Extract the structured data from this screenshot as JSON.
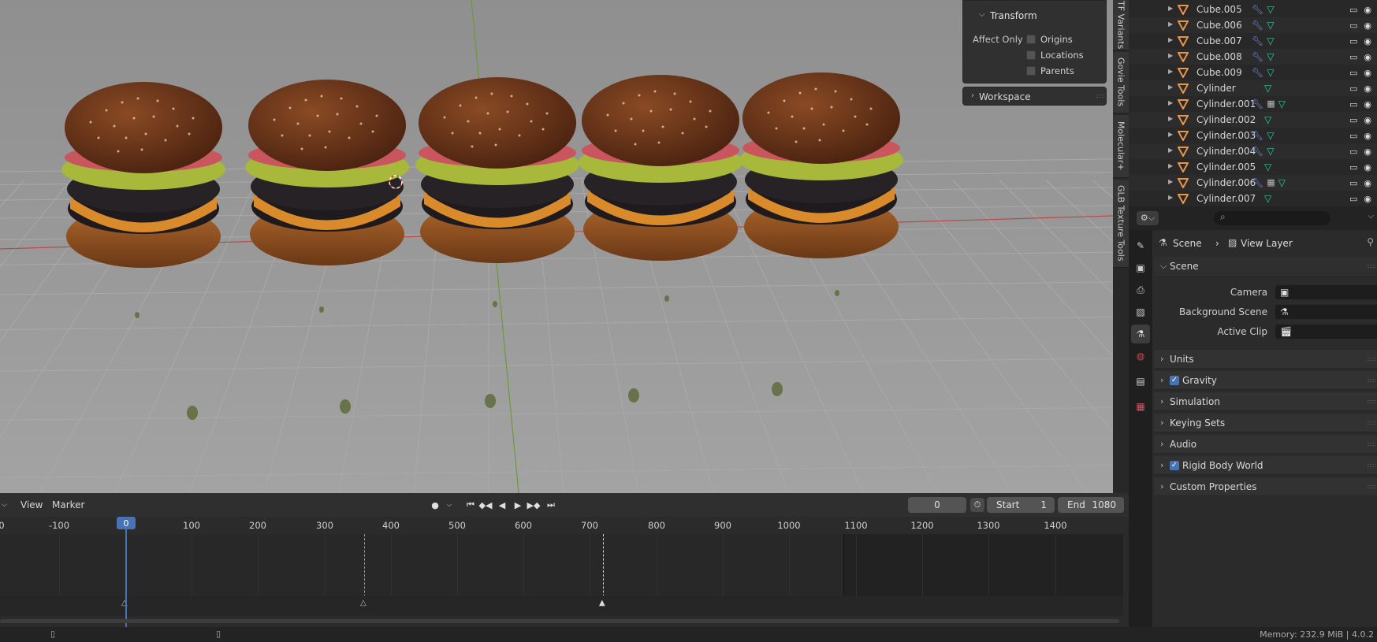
{
  "transform_panel": {
    "title": "Transform",
    "affect_only_label": "Affect Only",
    "options": [
      "Origins",
      "Locations",
      "Parents"
    ]
  },
  "workspace_panel": {
    "title": "Workspace"
  },
  "sidebar_tabs": [
    "TF Variants",
    "Govie Tools",
    "Molecular+",
    "GLB Texture Tools"
  ],
  "timeline": {
    "menus": {
      "view": "View",
      "marker": "Marker"
    },
    "current_frame_field": "0",
    "start_label": "Start",
    "start_value": "1",
    "end_label": "End",
    "end_value": "1080",
    "current_frame_badge": "0",
    "ruler_ticks": [
      "0",
      "-100",
      "100",
      "200",
      "300",
      "400",
      "500",
      "600",
      "700",
      "800",
      "900",
      "1000",
      "1100",
      "1200",
      "1300",
      "1400"
    ]
  },
  "outliner": {
    "rows": [
      {
        "name": "Cube.005",
        "mods": [
          "wrench",
          "mesh"
        ]
      },
      {
        "name": "Cube.006",
        "mods": [
          "wrench",
          "mesh"
        ]
      },
      {
        "name": "Cube.007",
        "mods": [
          "wrench",
          "mesh"
        ]
      },
      {
        "name": "Cube.008",
        "mods": [
          "wrench",
          "mesh"
        ]
      },
      {
        "name": "Cube.009",
        "mods": [
          "wrench",
          "mesh"
        ]
      },
      {
        "name": "Cylinder",
        "mods": [
          "mesh"
        ]
      },
      {
        "name": "Cylinder.001",
        "mods": [
          "wrench",
          "grid",
          "mesh"
        ]
      },
      {
        "name": "Cylinder.002",
        "mods": [
          "mesh"
        ]
      },
      {
        "name": "Cylinder.003",
        "mods": [
          "wrench",
          "mesh"
        ]
      },
      {
        "name": "Cylinder.004",
        "mods": [
          "wrench",
          "mesh"
        ]
      },
      {
        "name": "Cylinder.005",
        "mods": [
          "mesh"
        ]
      },
      {
        "name": "Cylinder.006",
        "mods": [
          "wrench",
          "grid",
          "mesh"
        ]
      },
      {
        "name": "Cylinder.007",
        "mods": [
          "mesh"
        ]
      }
    ]
  },
  "properties": {
    "breadcrumb": {
      "scene": "Scene",
      "view_layer": "View Layer"
    },
    "scene_section": "Scene",
    "fields": {
      "camera": "Camera",
      "background_scene": "Background Scene",
      "active_clip": "Active Clip"
    },
    "sections": [
      {
        "label": "Units",
        "checkbox": false
      },
      {
        "label": "Gravity",
        "checkbox": true
      },
      {
        "label": "Simulation",
        "checkbox": false
      },
      {
        "label": "Keying Sets",
        "checkbox": false
      },
      {
        "label": "Audio",
        "checkbox": false
      },
      {
        "label": "Rigid Body World",
        "checkbox": true
      },
      {
        "label": "Custom Properties",
        "checkbox": false
      }
    ]
  },
  "statusbar": {
    "memory": "Memory: 232.9 MiB | 4.0.2"
  },
  "colors": {
    "accent": "#4772b3",
    "axis_x": "#b84a4a",
    "axis_y": "#6c9a3a",
    "mesh_icon": "#38c9a0",
    "object_icon": "#e8954a",
    "wrench_icon": "#6a8ee8"
  }
}
